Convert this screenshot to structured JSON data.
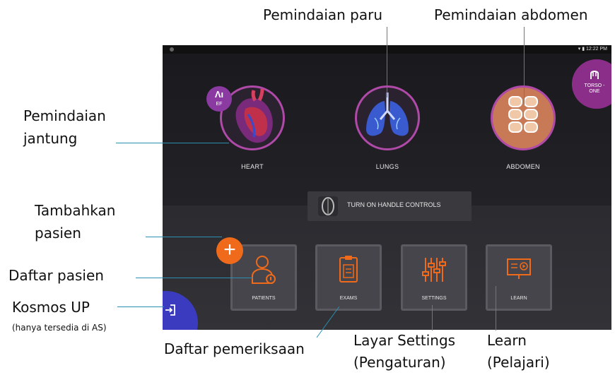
{
  "callouts": {
    "lung_scan": "Pemindaian paru",
    "abdomen_scan": "Pemindaian abdomen",
    "heart_scan_line1": "Pemindaian",
    "heart_scan_line2": "jantung",
    "add_patient_line1": "Tambahkan",
    "add_patient_line2": "pasien",
    "patient_list": "Daftar pasien",
    "kosmos_up": "Kosmos UP",
    "kosmos_up_note": "(hanya tersedia di AS)",
    "exam_list": "Daftar pemeriksaan",
    "settings_line1": "Layar Settings",
    "settings_line2": "(Pengaturan)",
    "learn_line1": "Learn",
    "learn_line2": "(Pelajari)"
  },
  "statusbar": {
    "time": "12:22 PM"
  },
  "presets": [
    {
      "label": "HEART",
      "badge": "EF",
      "icon": "heart-icon"
    },
    {
      "label": "LUNGS",
      "icon": "lungs-icon"
    },
    {
      "label": "ABDOMEN",
      "icon": "abdomen-icon"
    }
  ],
  "torso": {
    "label": "TORSO -ONE",
    "icon": "probe-icon"
  },
  "handle_controls": {
    "label": "TURN ON HANDLE CONTROLS"
  },
  "tiles": [
    {
      "label": "PATIENTS",
      "icon": "patient-icon"
    },
    {
      "label": "EXAMS",
      "icon": "clipboard-icon"
    },
    {
      "label": "SETTINGS",
      "icon": "sliders-icon"
    },
    {
      "label": "LEARN",
      "icon": "presentation-icon"
    }
  ],
  "colors": {
    "accent": "#ef6a1b",
    "preset_ring": "#b04aa8",
    "kosmos_up": "#3b3bbf",
    "torso": "#8a2e8a",
    "callout_line": "#2b8fb3"
  }
}
